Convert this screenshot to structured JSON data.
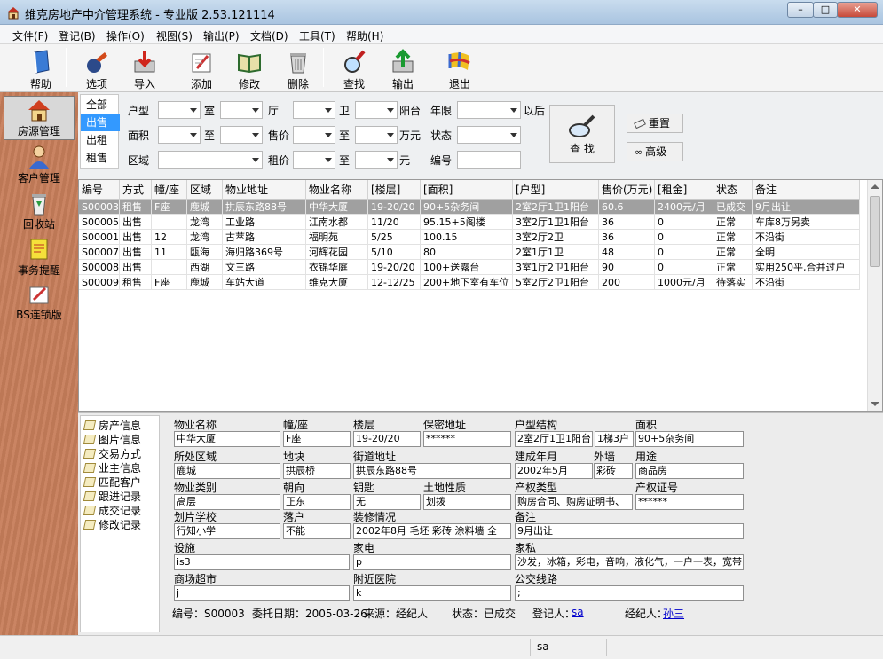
{
  "window": {
    "title": "维克房地产中介管理系统 - 专业版 2.53.121114"
  },
  "menu": [
    "文件(F)",
    "登记(B)",
    "操作(O)",
    "视图(S)",
    "输出(P)",
    "文档(D)",
    "工具(T)",
    "帮助(H)"
  ],
  "toolbar": {
    "help": "帮助",
    "options": "选项",
    "import": "导入",
    "add": "添加",
    "edit": "修改",
    "delete": "删除",
    "find": "查找",
    "export": "输出",
    "exit": "退出"
  },
  "sidebar": [
    "房源管理",
    "客户管理",
    "回收站",
    "事务提醒",
    "BS连锁版"
  ],
  "filter": {
    "tabs": [
      "全部",
      "出售",
      "出租",
      "租售"
    ],
    "labels": {
      "huxing": "户型",
      "shi": "室",
      "ting": "厅",
      "wei": "卫",
      "yangtai": "阳台",
      "nianxian": "年限",
      "yihou": "以后",
      "mianji": "面积",
      "zhi1": "至",
      "shoujia": "售价",
      "zhi2": "至",
      "wanyuan": "万元",
      "zhuangtai": "状态",
      "quyu": "区域",
      "zujia": "租价",
      "zhi3": "至",
      "yuan": "元",
      "bianhao": "编号"
    },
    "search": "查 找",
    "reset": "重置",
    "advanced": "高级"
  },
  "grid": {
    "columns": [
      "编号",
      "方式",
      "幢/座",
      "区域",
      "物业地址",
      "物业名称",
      "[楼层]",
      "[面积]",
      "[户型]",
      "售价(万元)",
      "[租金]",
      "状态",
      "备注"
    ],
    "rows": [
      [
        "S00003",
        "租售",
        "F座",
        "鹿城",
        "拱辰东路88号",
        "中华大厦",
        "19-20/20",
        "90+5杂务间",
        "2室2厅1卫1阳台",
        "60.6",
        "2400元/月",
        "已成交",
        "9月出让"
      ],
      [
        "S00005",
        "出售",
        "",
        "龙湾",
        "工业路",
        "江南水都",
        "11/20",
        "95.15+5阁楼",
        "3室2厅1卫1阳台",
        "36",
        "0",
        "正常",
        "车库8万另卖"
      ],
      [
        "S00001",
        "出售",
        "12",
        "龙湾",
        "古萃路",
        "福明苑",
        "5/25",
        "100.15",
        "3室2厅2卫",
        "36",
        "0",
        "正常",
        "不沿街"
      ],
      [
        "S00007",
        "出售",
        "11",
        "瓯海",
        "海归路369号",
        "河辉花园",
        "5/10",
        "80",
        "2室1厅1卫",
        "48",
        "0",
        "正常",
        "全明"
      ],
      [
        "S00008",
        "出售",
        "",
        "西湖",
        "文三路",
        "衣锦华庭",
        "19-20/20",
        "100+送露台",
        "3室1厅2卫1阳台",
        "90",
        "0",
        "正常",
        "实用250平,合并过户"
      ],
      [
        "S00009",
        "租售",
        "F座",
        "鹿城",
        "车站大道",
        "维克大厦",
        "12-12/25",
        "200+地下室有车位",
        "5室2厅2卫1阳台",
        "200",
        "1000元/月",
        "待落实",
        "不沿街"
      ]
    ]
  },
  "tree": [
    "房产信息",
    "图片信息",
    "交易方式",
    "业主信息",
    "匹配客户",
    "跟进记录",
    "成交记录",
    "修改记录"
  ],
  "detail": {
    "l_wymc": "物业名称",
    "v_wymc": "中华大厦",
    "l_zz": "幢/座",
    "v_zz": "F座",
    "l_lc": "楼层",
    "v_lc": "19-20/20",
    "l_bmdz": "保密地址",
    "v_bmdz": "******",
    "l_hxjg": "户型结构",
    "v_hxjg": "2室2厅1卫1阳台",
    "v_hxjg2": "1梯3户",
    "l_mj": "面积",
    "v_mj": "90+5杂务间",
    "l_ssqy": "所处区域",
    "v_ssqy": "鹿城",
    "l_dk": "地块",
    "v_dk": "拱辰桥",
    "l_jddz": "街道地址",
    "v_jddz": "拱辰东路88号",
    "l_jcnf": "建成年月",
    "v_jcnf": "2002年5月",
    "l_wq": "外墙",
    "v_wq": "彩砖",
    "l_yt": "用途",
    "v_yt": "商品房",
    "l_wylb": "物业类别",
    "v_wylb": "高层",
    "l_cx": "朝向",
    "v_cx": "正东",
    "l_ys": "钥匙",
    "v_ys": "无",
    "l_tdxz": "土地性质",
    "v_tdxz": "划拨",
    "l_cqlx": "产权类型",
    "v_cqlx": "购房合同、购房证明书、",
    "l_cqzh": "产权证号",
    "v_cqzh": "******",
    "l_hpxx": "划片学校",
    "v_hpxx": "行知小学",
    "l_lh": "落户",
    "v_lh": "不能",
    "l_zxqk": "装修情况",
    "v_zxqk": "2002年8月 毛坯 彩砖 涂料墙 全",
    "l_bz": "备注",
    "v_bz": "9月出让",
    "l_ss": "设施",
    "v_ss": "is3",
    "l_jd": "家电",
    "v_jd": "p",
    "l_js": "家私",
    "v_js": "沙发，冰箱，彩电，音响，液化气，一户一表，宽带",
    "l_sccs": "商场超市",
    "v_sccs": "j",
    "l_fjyy": "附近医院",
    "v_fjyy": "k",
    "l_gjxl": "公交线路",
    "v_gjxl": ";"
  },
  "footer": {
    "bh": "编号：S00003",
    "wtrq": "委托日期：2005-03-26",
    "ly": "来源：经纪人",
    "zt": "状态：已成交",
    "djr": "登记人：",
    "djr_v": "sa",
    "jjr": "经纪人：",
    "jjr_v": "孙三"
  },
  "status": {
    "user": "sa"
  }
}
